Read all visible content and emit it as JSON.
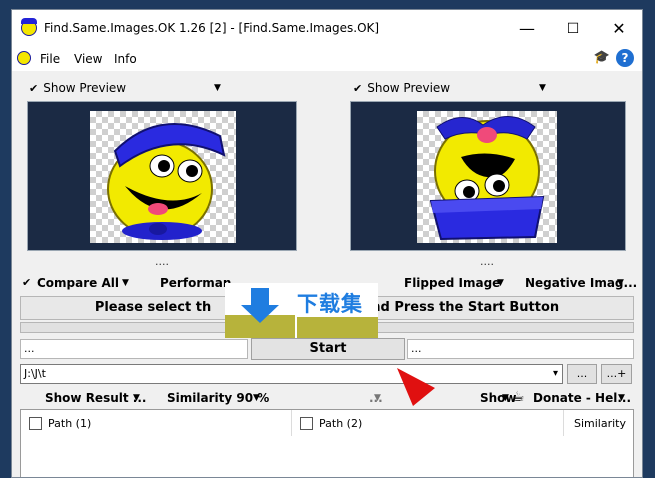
{
  "window": {
    "title": "Find.Same.Images.OK 1.26 [2] - [Find.Same.Images.OK]",
    "minimize": "—",
    "maximize": "☐",
    "close": "✕"
  },
  "menu": {
    "items": [
      "File",
      "View",
      "Info"
    ],
    "help": "?",
    "hat": "🎓"
  },
  "preview_left": {
    "label": "Show Preview",
    "check": "✔",
    "dots": "...."
  },
  "preview_right": {
    "label": "Show Preview",
    "check": "✔",
    "dots": "...."
  },
  "options": {
    "compare_all": "Compare All",
    "performance": "Performan",
    "flipped_image": "Flipped Image",
    "negative_image": "Negative Imag...",
    "check": "✔"
  },
  "banner": {
    "text_left": "Please select th",
    "text_right": "nd Press the Start Button"
  },
  "fields": {
    "left_dots": "...",
    "right_dots": "...",
    "start": "Start"
  },
  "path": {
    "value": "J:\\J\\t",
    "browse": "...",
    "add": "...+"
  },
  "results_bar": {
    "show_result": "Show Result ...",
    "similarity": "Similarity 90 %",
    "middle": "...",
    "show": "Show",
    "donate": "Donate - Hel..."
  },
  "columns": {
    "path1": "Path (1)",
    "path2": "Path (2)",
    "similarity": "Similarity"
  },
  "watermark": {
    "text": "下载集"
  },
  "colors": {
    "accent_blue": "#1f7de0",
    "preview_bg": "#1b2a44",
    "arrow_red": "#e01010"
  }
}
